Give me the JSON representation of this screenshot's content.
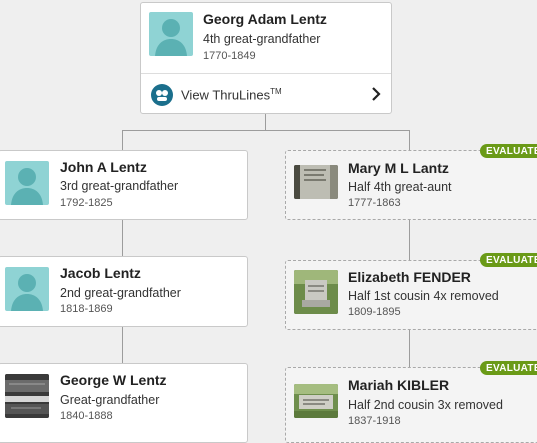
{
  "root": {
    "name": "Georg Adam Lentz",
    "relationship": "4th great-grandfather",
    "dates": "1770-1849",
    "thrulines_label": "View ThruLines",
    "thrulines_tm": "TM"
  },
  "left_branch": [
    {
      "name": "John A Lentz",
      "relationship": "3rd great-grandfather",
      "dates": "1792-1825",
      "photo": "silhouette"
    },
    {
      "name": "Jacob Lentz",
      "relationship": "2nd great-grandfather",
      "dates": "1818-1869",
      "photo": "silhouette"
    },
    {
      "name": "George W Lentz",
      "relationship": "Great-grandfather",
      "dates": "1840-1888",
      "photo": "gravestone"
    }
  ],
  "right_branch": [
    {
      "name": "Mary M L Lantz",
      "relationship": "Half 4th great-aunt",
      "dates": "1777-1863",
      "badge": "EVALUATE",
      "photo": "gravestone"
    },
    {
      "name": "Elizabeth FENDER",
      "relationship": "Half 1st cousin 4x removed",
      "dates": "1809-1895",
      "badge": "EVALUATE",
      "photo": "gravestone"
    },
    {
      "name": "Mariah KIBLER",
      "relationship": "Half 2nd cousin 3x removed",
      "dates": "1837-1918",
      "badge": "EVALUATE",
      "photo": "gravestone"
    }
  ],
  "colors": {
    "badge": "#6a9a17",
    "silhouette_bg": "#8fd3d4",
    "thrulines_icon": "#1b6f8c",
    "connector": "#9c9c9c"
  }
}
